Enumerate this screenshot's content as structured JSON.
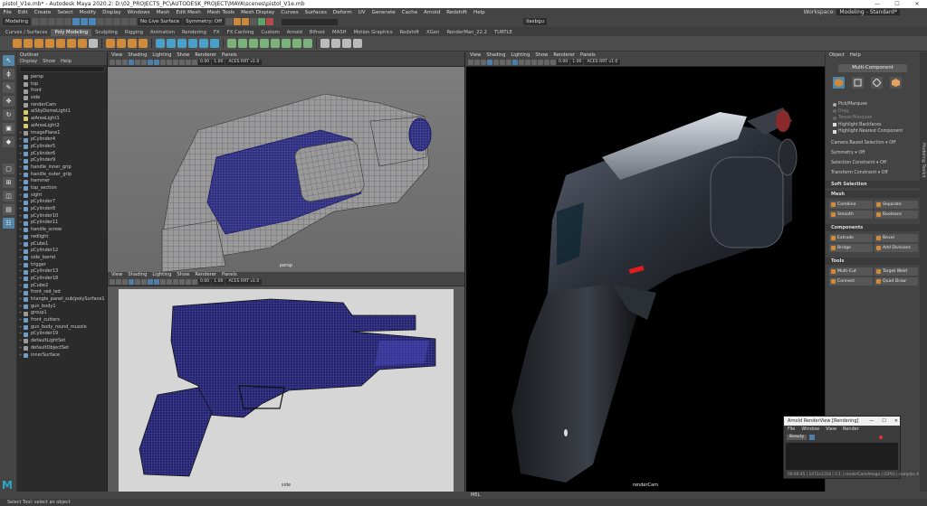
{
  "window": {
    "title": "pistol_V1e.mb* - Autodesk Maya 2020.2: D:\\02_PROJECTS_PC\\AUTODESK_PROJECT\\MAYA\\scenes\\pistol_V1e.mb",
    "min": "—",
    "max": "☐",
    "close": "✕"
  },
  "menubar": {
    "items": [
      "File",
      "Edit",
      "Create",
      "Select",
      "Modify",
      "Display",
      "Windows",
      "Mesh",
      "Edit Mesh",
      "Mesh Tools",
      "Mesh Display",
      "Curves",
      "Surfaces",
      "Deform",
      "UV",
      "Generate",
      "Cache",
      "Arnold",
      "Redshift",
      "Help"
    ],
    "workspace_label": "Workspace:",
    "workspace_value": "Modeling - Standard*"
  },
  "statusline": {
    "mode": "Modeling",
    "live_surface": "No Live Surface",
    "symmetry": "Symmetry: Off",
    "user": "liasbgu"
  },
  "shelf_tabs": [
    "Curves / Surfaces",
    "Poly Modeling",
    "Sculpting",
    "Rigging",
    "Animation",
    "Rendering",
    "FX",
    "FX Caching",
    "Custom",
    "Arnold",
    "Bifrost",
    "MASH",
    "Motion Graphics",
    "Redshift",
    "XGen",
    "RenderMan_22.2",
    "TURTLE"
  ],
  "shelf_active": 1,
  "outliner": {
    "title": "Outliner",
    "menu": [
      "Display",
      "Show",
      "Help"
    ],
    "items": [
      {
        "name": "persp",
        "icon": "c"
      },
      {
        "name": "top",
        "icon": "c"
      },
      {
        "name": "front",
        "icon": "c"
      },
      {
        "name": "side",
        "icon": "c"
      },
      {
        "name": "renderCam",
        "icon": "c"
      },
      {
        "name": "aiSkyDomeLight1",
        "icon": "l"
      },
      {
        "name": "aiAreaLight1",
        "icon": "l"
      },
      {
        "name": "aiAreaLight2",
        "icon": "l"
      },
      {
        "name": "imagePlane1",
        "icon": "g"
      },
      {
        "name": "pCylinder4",
        "icon": "s"
      },
      {
        "name": "pCylinder5",
        "icon": "s"
      },
      {
        "name": "pCylinder6",
        "icon": "s"
      },
      {
        "name": "pCylinder9",
        "icon": "s"
      },
      {
        "name": "handle_inner_grip",
        "icon": "s"
      },
      {
        "name": "handle_outer_grip",
        "icon": "s"
      },
      {
        "name": "hammer",
        "icon": "s"
      },
      {
        "name": "top_section",
        "icon": "s"
      },
      {
        "name": "sight",
        "icon": "s"
      },
      {
        "name": "pCylinder7",
        "icon": "s"
      },
      {
        "name": "pCylinder8",
        "icon": "s"
      },
      {
        "name": "pCylinder10",
        "icon": "s"
      },
      {
        "name": "pCylinder11",
        "icon": "s"
      },
      {
        "name": "handle_screw",
        "icon": "s"
      },
      {
        "name": "redlight",
        "icon": "s"
      },
      {
        "name": "pCube1",
        "icon": "s"
      },
      {
        "name": "pCylinder12",
        "icon": "s"
      },
      {
        "name": "side_barrel",
        "icon": "s"
      },
      {
        "name": "trigger",
        "icon": "s"
      },
      {
        "name": "pCylinder13",
        "icon": "s"
      },
      {
        "name": "pCylinder18",
        "icon": "s"
      },
      {
        "name": "pCube2",
        "icon": "s"
      },
      {
        "name": "front_red_led",
        "icon": "s"
      },
      {
        "name": "triangle_panel_sub|polySurface1",
        "icon": "s"
      },
      {
        "name": "gun_body1",
        "icon": "s"
      },
      {
        "name": "group1",
        "icon": "g"
      },
      {
        "name": "front_cutters",
        "icon": "s"
      },
      {
        "name": "gun_body_round_muzzle",
        "icon": "s"
      },
      {
        "name": "pCylinder19",
        "icon": "s"
      },
      {
        "name": "defaultLightSet",
        "icon": "g"
      },
      {
        "name": "defaultObjectSet",
        "icon": "g"
      },
      {
        "name": "innerSurface",
        "icon": "s"
      }
    ]
  },
  "viewports": {
    "menu": [
      "View",
      "Shading",
      "Lighting",
      "Show",
      "Renderer",
      "Panels"
    ],
    "num1": "0.00",
    "num2": "1.00",
    "aces": "ACES RRT v1.0",
    "persp_label": "persp",
    "side_label": "side",
    "render_label": "renderCam"
  },
  "mtk": {
    "tabs": [
      "Object",
      "Help"
    ],
    "multi_component": "Multi-Component",
    "pick_marquee": "Pick/Marquee",
    "drag": "Drag",
    "tweak_marquee": "Tweak/Marquee",
    "highlight_backfaces": "Highlight Backfaces",
    "highlight_nearest": "Highlight Nearest Component",
    "camera_based": "Camera Based Selection",
    "symmetry": "Symmetry",
    "selection_constraint": "Selection Constraint",
    "transform_constraint": "Transform Constraint",
    "off": "Off",
    "soft_selection": "Soft Selection",
    "mesh": "Mesh",
    "combine": "Combine",
    "separate": "Separate",
    "smooth": "Smooth",
    "booleans": "Booleans",
    "components": "Components",
    "extrude": "Extrude",
    "bevel": "Bevel",
    "bridge": "Bridge",
    "add_divisions": "Add Divisions",
    "tools": "Tools",
    "multi_cut": "Multi-Cut",
    "target_weld": "Target Weld",
    "connect": "Connect",
    "quad_draw": "Quad Draw",
    "side_tab": "Modeling Toolkit"
  },
  "arnold": {
    "title": "Arnold RenderView [Rendering]",
    "menu": [
      "File",
      "Window",
      "View",
      "Render"
    ],
    "dropdown": "Beauty",
    "status": "00:00:45 | 1472x1118 | 1:1 | renderCam/Image | [GPU] | samples 4"
  },
  "cmdline": {
    "label": "MEL"
  },
  "helpline": {
    "text": "Select Tool: select an object"
  },
  "colors": {
    "wire": "#2a2a9e",
    "selected": "#5285a6",
    "accent": "#d08a3a"
  }
}
